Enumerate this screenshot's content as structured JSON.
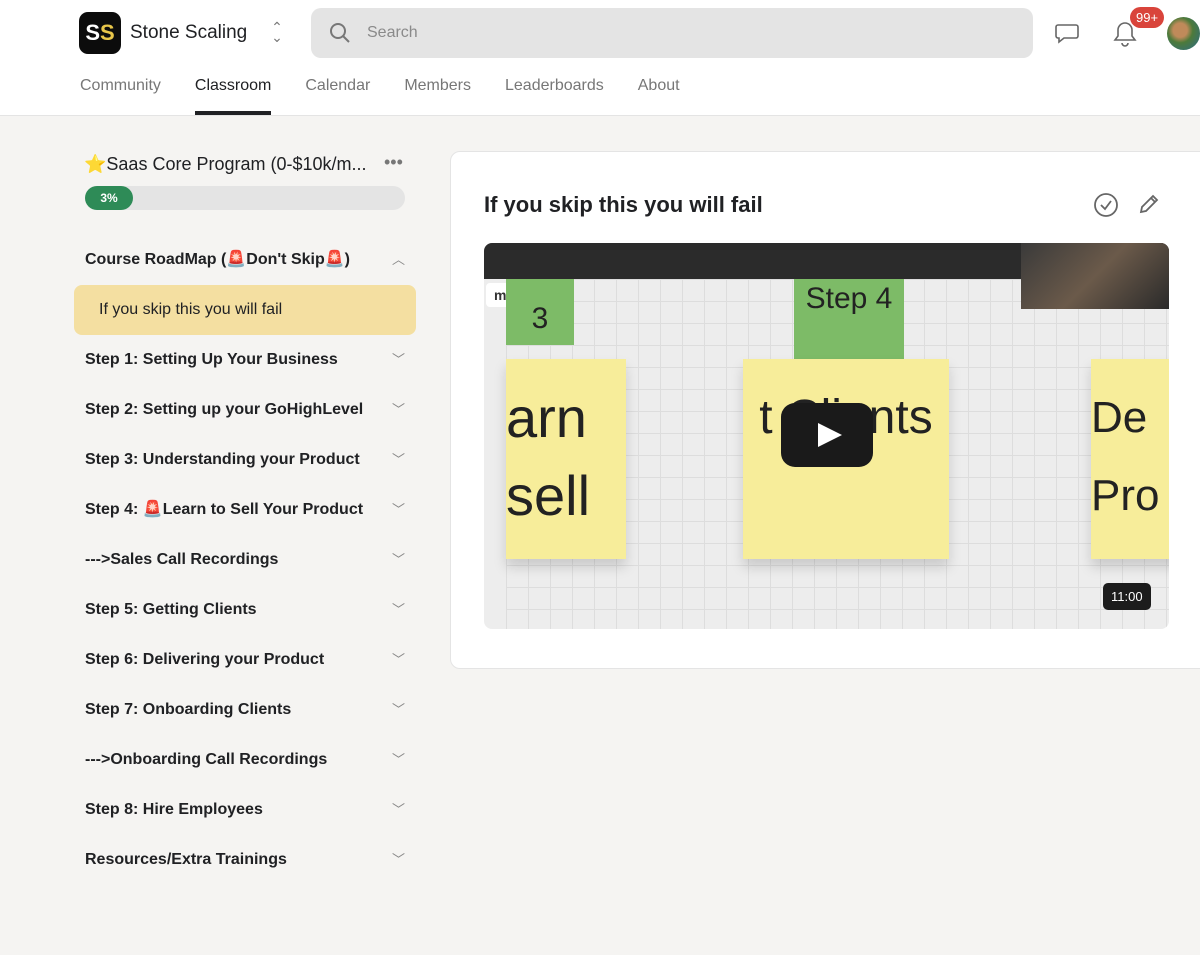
{
  "header": {
    "logo_text": "SS",
    "group_name": "Stone Scaling",
    "search_placeholder": "Search",
    "notification_count": "99+"
  },
  "tabs": [
    "Community",
    "Classroom",
    "Calendar",
    "Members",
    "Leaderboards",
    "About"
  ],
  "course": {
    "title": "⭐Saas Core Program (0-$10k/m...",
    "progress_percent": 3,
    "progress_label": "3%"
  },
  "modules": [
    {
      "label": "Course RoadMap (🚨Don't Skip🚨)",
      "expanded": true
    },
    {
      "label": "Step 1: Setting Up Your Business"
    },
    {
      "label": "Step 2: Setting up your GoHighLevel"
    },
    {
      "label": "Step 3: Understanding your Product"
    },
    {
      "label": "Step 4: 🚨Learn to Sell Your Product"
    },
    {
      "label": "--->Sales Call Recordings"
    },
    {
      "label": "Step 5: Getting Clients"
    },
    {
      "label": "Step 6: Delivering your Product"
    },
    {
      "label": "Step 7: Onboarding Clients"
    },
    {
      "label": "--->Onboarding Call Recordings"
    },
    {
      "label": "Step 8: Hire Employees"
    },
    {
      "label": "Resources/Extra Trainings"
    }
  ],
  "active_lesson": "If you skip this you will fail",
  "lesson": {
    "title": "If you skip this you will fail",
    "video_duration": "11:00",
    "video_text": {
      "miro": "miro",
      "step4": "Step 4",
      "step3": "3",
      "learn_sell": "arn sell",
      "get_clients": "t Clients",
      "deliver": "De Pro"
    }
  },
  "colors": {
    "accent": "#2e8b57",
    "highlight": "#f4dfa1",
    "badge": "#d9443b"
  }
}
